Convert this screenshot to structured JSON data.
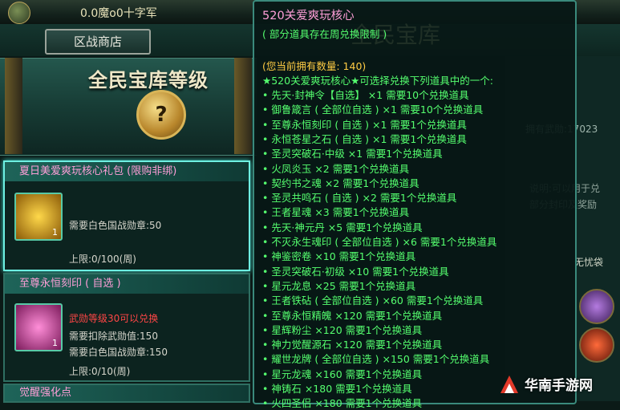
{
  "top_bar": {
    "title": "0.0魔o0十字军"
  },
  "tabs": {
    "shop": "区战商店"
  },
  "banner": {
    "title": "全民宝库等级",
    "medal_glyph": "?"
  },
  "right_panel": {
    "coins_label": "拥有武勋:17023",
    "desc_line1": "说明:可以用于兑",
    "desc_line2": "部分封印及奖励",
    "relic_label": "无忧袋"
  },
  "cards": [
    {
      "title": "夏日美爱爽玩核心礼包 (限购非绑)",
      "count": "1",
      "require": "需要白色国战勋章:50",
      "limit": "上限:0/100(周)",
      "highlighted": true
    },
    {
      "title": "至尊永恒刻印 ( 自选 )",
      "count": "1",
      "warning": "武勋等级30可以兑换",
      "require1": "需要扣除武勋值:150",
      "require2": "需要白色国战勋章:150",
      "limit": "上限:0/10(周)"
    },
    {
      "title": "觉醒强化点"
    }
  ],
  "tooltip": {
    "title": "520关爱爽玩核心",
    "note": "( 部分道具存在周兑换限制 )",
    "watermark": "全民宝库",
    "owned": "(您当前拥有数量: 140)",
    "header": "★520关爱爽玩核心★可选择兑换下列道具中的一个:",
    "items": [
      "• 先天·封神令【自选】 ×1   需要10个兑换道具",
      "• 御鲁箴言 ( 全部位自选 ) ×1   需要10个兑换道具",
      "• 至尊永恒刻印 ( 自选 ) ×1   需要1个兑换道具",
      "• 永恒苍星之石 ( 自选 ) ×1   需要1个兑换道具",
      "• 圣灵突破石·中级 ×1   需要1个兑换道具",
      "• 火凤炎玉 ×2   需要1个兑换道具",
      "• 契约书之魂 ×2   需要1个兑换道具",
      "• 圣灵共鸣石 ( 自选 ) ×2   需要1个兑换道具",
      "• 王者星魂 ×3   需要1个兑换道具",
      "• 先天·神元丹 ×5   需要1个兑换道具",
      "• 不灭永生魂印 ( 全部位自选 ) ×6   需要1个兑换道具",
      "• 神鉴密卷 ×10   需要1个兑换道具",
      "• 圣灵突破石·初级 ×10   需要1个兑换道具",
      "• 星元龙息 ×25   需要1个兑换道具",
      "• 王者铁砧 ( 全部位自选 ) ×60   需要1个兑换道具",
      "• 至尊永恒精魄 ×120   需要1个兑换道具",
      "• 星辉粉尘 ×120   需要1个兑换道具",
      "• 神力觉醒源石 ×120   需要1个兑换道具",
      "• 耀世龙牌 ( 全部位自选 ) ×150   需要1个兑换道具",
      "• 星元龙魂 ×160   需要1个兑换道具",
      "• 神铸石 ×180   需要1个兑换道具",
      "• 火四圣侣 ×180   需要1个兑换道具"
    ]
  },
  "watermark": {
    "text": "华南手游网"
  },
  "colors": {
    "accent": "#6ef0e2",
    "tooltip_green": "#55ff6f",
    "tooltip_orange": "#ffcc44",
    "card_title_pink": "#ff9fd8",
    "warning_red": "#ff4646"
  }
}
